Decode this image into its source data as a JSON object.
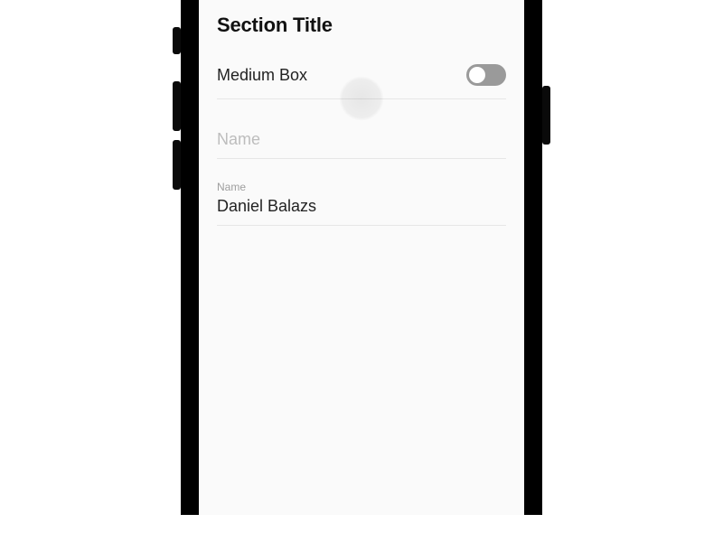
{
  "section": {
    "title": "Section Title"
  },
  "toggle": {
    "label": "Medium Box",
    "checked": false
  },
  "field_empty": {
    "placeholder": "Name"
  },
  "field_filled": {
    "label": "Name",
    "value": "Daniel Balazs"
  }
}
